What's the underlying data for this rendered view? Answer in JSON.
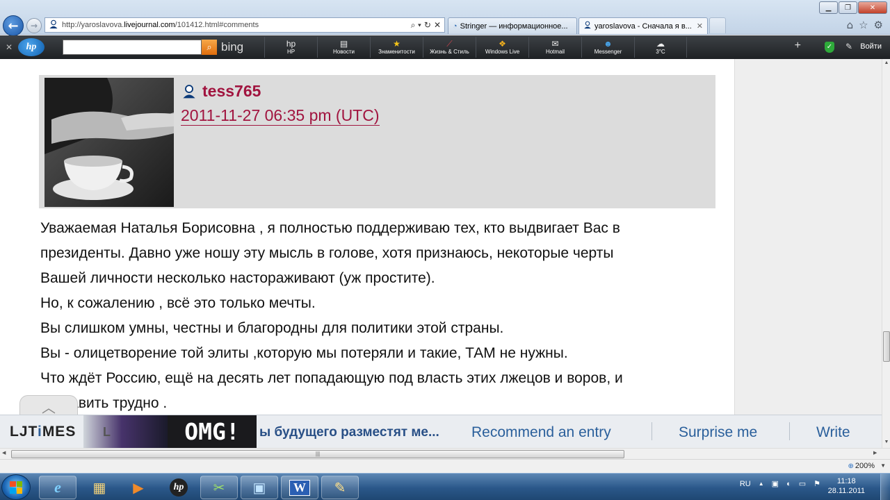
{
  "browser": {
    "window_buttons": {
      "minimize": "▁",
      "maximize": "❐",
      "close": "✕"
    },
    "back_label": "←",
    "forward_label": "→",
    "address": {
      "prefix": "http://yaroslavova.",
      "domain": "livejournal.com",
      "path": "/101412.html#comments",
      "search_icon": "⌕ ▾",
      "refresh_icon": "↻",
      "stop_icon": "✕"
    },
    "tabs": [
      {
        "label": "Stringer — информационное...",
        "active": false
      },
      {
        "label": "yaroslavova - Сначала я в...",
        "active": true,
        "close": "✕"
      }
    ],
    "toolbar_icons": {
      "home": "⌂",
      "favorites": "☆",
      "tools": "⚙"
    }
  },
  "hp_toolbar": {
    "close": "✕",
    "logo": "hp",
    "search_placeholder": "",
    "bing_label": "bing",
    "items": [
      {
        "icon": "hp",
        "label": "HP"
      },
      {
        "icon": "▤",
        "label": "Новости"
      },
      {
        "icon": "★",
        "label": "Знаменитости"
      },
      {
        "icon": "⟋",
        "label": "Жизнь & Стиль"
      },
      {
        "icon": "❖",
        "label": "Windows Live"
      },
      {
        "icon": "✉",
        "label": "Hotmail"
      },
      {
        "icon": "☻",
        "label": "Messenger"
      },
      {
        "icon": "☁",
        "label": "3°C"
      }
    ],
    "plus": "+",
    "login": "Войти"
  },
  "comment": {
    "username": "tess765",
    "timestamp": "2011-11-27 06:35 pm (UTC)",
    "lines": [
      "Уважаемая Наталья Борисовна , я полностью поддерживаю тех, кто выдвигает Вас в",
      "президенты. Давно уже ношу эту мысль в голове, хотя признаюсь, некоторые черты",
      "Вашей личности несколько настораживают (уж простите).",
      "Но, к сожалению , всё это только мечты.",
      "Вы слишком умны, честны и благородны для политики этой страны.",
      "Вы - олицетворение той элиты ,которую мы потеряли и такие, ТАМ не нужны.",
      "Что ждёт Россию, ещё на десять лет попадающую под власть этих лжецов и воров, и",
      "    ставить трудно ."
    ],
    "scroll_top_icon": "︿"
  },
  "ljtimes": {
    "logo_a": "LJT",
    "logo_b": "i",
    "logo_c": "MES",
    "ticker_prefix": "L",
    "omg": "OMG!",
    "headline": "ы будущего разместят ме...",
    "recommend": "Recommend an entry",
    "surprise": "Surprise me",
    "write": "Write"
  },
  "scrollbars": {
    "up": "▲",
    "down": "▼",
    "left": "◀",
    "right": "▶",
    "grip": "|||"
  },
  "status": {
    "zoom": "200%",
    "zoom_arrow": "▼"
  },
  "taskbar": {
    "apps": [
      {
        "icon": "e",
        "name": "internet-explorer"
      },
      {
        "icon": "▦",
        "name": "windows-explorer"
      },
      {
        "icon": "▶",
        "name": "media-player"
      },
      {
        "icon": "hp",
        "name": "hp-app"
      },
      {
        "icon": "✂",
        "name": "people-app"
      },
      {
        "icon": "▣",
        "name": "control-panel"
      },
      {
        "icon": "W",
        "name": "word"
      },
      {
        "icon": "✎",
        "name": "paint"
      }
    ],
    "lang": "RU",
    "tray_icons": [
      "▲",
      "▣",
      "◐",
      "▭",
      "⚑"
    ],
    "time": "11:18",
    "date": "28.11.2011"
  }
}
